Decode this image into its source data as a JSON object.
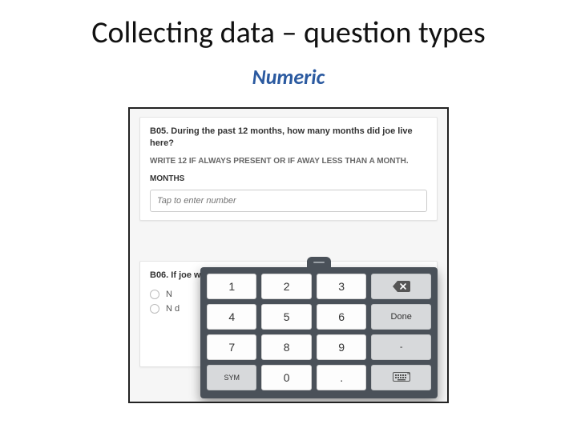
{
  "title": "Collecting data – question types",
  "subtitle": "Numeric",
  "survey": {
    "q05": {
      "text": "B05. During the past 12 months, how many months did joe live here?",
      "instruction": "WRITE 12 IF ALWAYS PRESENT OR IF AWAY LESS THAN A MONTH.",
      "unit_label": "MONTHS",
      "placeholder": "Tap to enter number"
    },
    "q06": {
      "text": "B06. If joe was away, what was the main reason?",
      "options": [
        "N",
        "N d"
      ]
    }
  },
  "keypad": {
    "rows": [
      [
        "1",
        "2",
        "3"
      ],
      [
        "4",
        "5",
        "6"
      ],
      [
        "7",
        "8",
        "9"
      ],
      [
        "SYM",
        "0",
        "."
      ]
    ],
    "side": {
      "backspace": "⌫",
      "done": "Done",
      "dash": "-",
      "kb": "keyboard"
    }
  }
}
